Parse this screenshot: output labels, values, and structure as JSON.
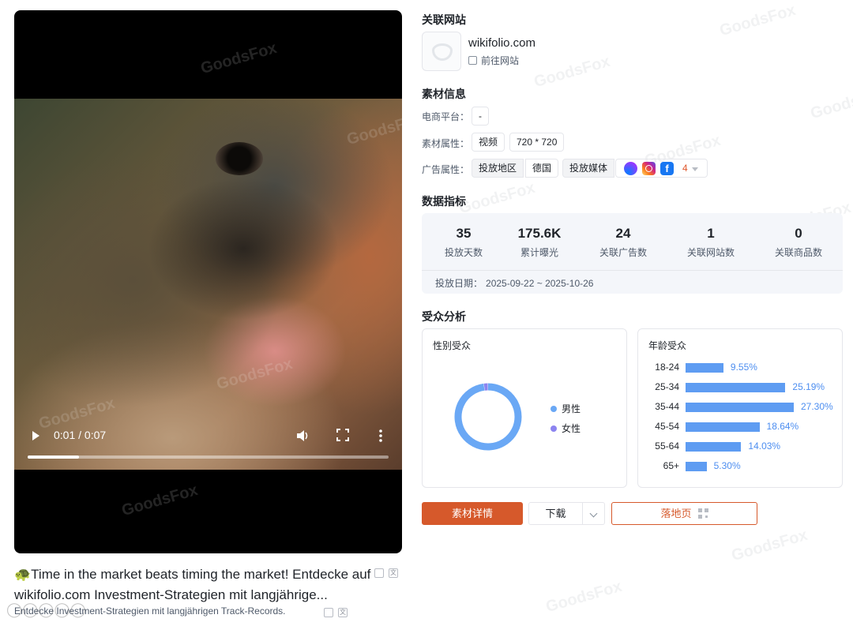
{
  "video": {
    "current_time": "0:01",
    "separator": "/",
    "duration": "0:07",
    "progress": 0.143
  },
  "caption": {
    "main": "🐢Time in the market beats timing the market! Entdecke auf wikifolio.com Investment-Strategien mit langjährige...",
    "sub": "Entdecke Investment-Strategien mit langjährigen Track-Records.",
    "translate_glyph": "文"
  },
  "related_site": {
    "section_title": "关联网站",
    "domain": "wikifolio.com",
    "link_label": "前往网站"
  },
  "material_info": {
    "section_title": "素材信息",
    "platform_label": "电商平台：",
    "platform_value": "-",
    "attr_label": "素材属性：",
    "attr_type": "视频",
    "attr_size": "720 * 720",
    "ad_label": "广告属性：",
    "region_label": "投放地区",
    "region_value": "德国",
    "media_label": "投放媒体",
    "media_icons": [
      "messenger-icon",
      "instagram-icon",
      "facebook-icon"
    ],
    "facebook_glyph": "f",
    "media_count": "4"
  },
  "metrics": {
    "section_title": "数据指标",
    "items": [
      {
        "value": "35",
        "label": "投放天数"
      },
      {
        "value": "175.6K",
        "label": "累计曝光"
      },
      {
        "value": "24",
        "label": "关联广告数"
      },
      {
        "value": "1",
        "label": "关联网站数"
      },
      {
        "value": "0",
        "label": "关联商品数"
      }
    ],
    "date_label": "投放日期：",
    "date_range": "2025-09-22 ~ 2025-10-26"
  },
  "audience": {
    "section_title": "受众分析",
    "gender_title": "性别受众",
    "age_title": "年龄受众"
  },
  "chart_data": [
    {
      "type": "pie",
      "title": "性别受众",
      "categories": [
        "男性",
        "女性"
      ],
      "values": [
        98,
        2
      ],
      "colors": [
        "#6aa8f5",
        "#8c84f0"
      ]
    },
    {
      "type": "bar",
      "title": "年龄受众",
      "orientation": "horizontal",
      "categories": [
        "18-24",
        "25-34",
        "35-44",
        "45-54",
        "55-64",
        "65+"
      ],
      "values": [
        9.55,
        25.19,
        27.3,
        18.64,
        14.03,
        5.3
      ],
      "value_labels": [
        "9.55%",
        "25.19%",
        "27.30%",
        "18.64%",
        "14.03%",
        "5.30%"
      ],
      "color": "#5e9cf2"
    }
  ],
  "actions": {
    "detail": "素材详情",
    "download": "下载",
    "landing": "落地页"
  },
  "watermark_text": "GoodsFox",
  "colors": {
    "accent": "#d6592b",
    "bar": "#5e9cf2",
    "male": "#6aa8f5",
    "female": "#8c84f0"
  }
}
